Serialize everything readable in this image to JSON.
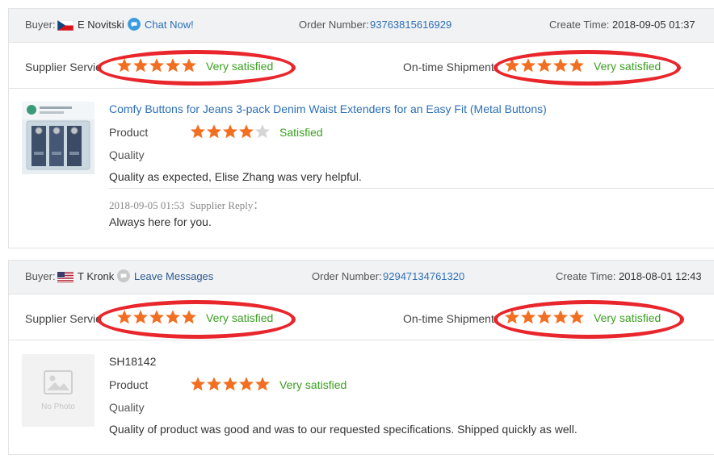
{
  "orders": [
    {
      "buyer_label": "Buyer:",
      "buyer_name": "E Novitski",
      "buyer_flag": "czech-flag",
      "contact_label": "Chat Now!",
      "order_label": "Order Number:",
      "order_number": "93763815616929",
      "time_label": "Create Time:",
      "create_time": "2018-09-05 01:37",
      "supplier_service_label": "Supplier Servic",
      "supplier_service_rating": 5,
      "supplier_service_text": "Very satisfied",
      "shipment_label": "On-time Shipment",
      "shipment_rating": 5,
      "shipment_text": "Very satisfied",
      "product_title": "Comfy Buttons for Jeans 3-pack Denim Waist Extenders for an Easy Fit (Metal Buttons)",
      "product_label": "Product",
      "product_rating": 4,
      "product_rating_text": "Satisfied",
      "quality_label": "Quality",
      "review_text": "Quality as expected, Elise Zhang was very helpful.",
      "reply_time": "2018-09-05 01:53",
      "reply_label": "Supplier Reply：",
      "reply_text": "Always here for you."
    },
    {
      "buyer_label": "Buyer:",
      "buyer_name": "T Kronk",
      "buyer_flag": "us-flag",
      "contact_label": "Leave Messages",
      "order_label": "Order Number:",
      "order_number": "92947134761320",
      "time_label": "Create Time:",
      "create_time": "2018-08-01 12:43",
      "supplier_service_label": "Supplier Servic",
      "supplier_service_rating": 5,
      "supplier_service_text": "Very satisfied",
      "shipment_label": "On-time Shipment",
      "shipment_rating": 5,
      "shipment_text": "Very satisfied",
      "product_title": "SH18142",
      "no_photo_text": "No Photo",
      "product_label": "Product",
      "product_rating": 5,
      "product_rating_text": "Very satisfied",
      "quality_label": "Quality",
      "review_text": "Quality of product was good and was to our requested specifications. Shipped quickly as well."
    }
  ],
  "colors": {
    "star_filled": "#f26f21",
    "star_empty": "#d6d6d6",
    "satisfied_green": "#3aa020",
    "link_blue": "#2d6fb5",
    "annotation_red": "#e8262c",
    "header_bg": "#f1f2f4"
  }
}
